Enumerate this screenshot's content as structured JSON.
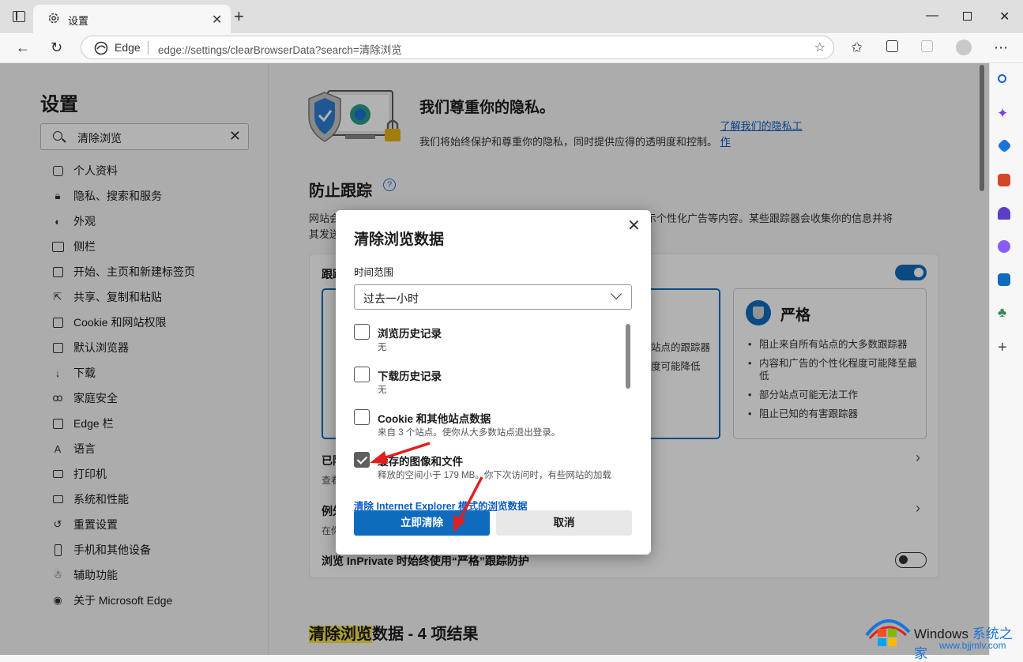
{
  "browser": {
    "tab_title": "设置",
    "address_site": "Edge",
    "address_url": "edge://settings/clearBrowserData?search=清除浏览"
  },
  "nav": {
    "title": "设置",
    "search_value": "清除浏览",
    "items": [
      {
        "label": "个人资料",
        "icon": "profile-icon"
      },
      {
        "label": "隐私、搜索和服务",
        "icon": "lock-icon"
      },
      {
        "label": "外观",
        "icon": "palette-icon"
      },
      {
        "label": "侧栏",
        "icon": "sidebar-icon"
      },
      {
        "label": "开始、主页和新建标签页",
        "icon": "home-icon"
      },
      {
        "label": "共享、复制和粘贴",
        "icon": "share-icon"
      },
      {
        "label": "Cookie 和网站权限",
        "icon": "cookie-icon"
      },
      {
        "label": "默认浏览器",
        "icon": "browser-icon"
      },
      {
        "label": "下载",
        "icon": "download-icon"
      },
      {
        "label": "家庭安全",
        "icon": "family-icon"
      },
      {
        "label": "Edge 栏",
        "icon": "edge-bar-icon"
      },
      {
        "label": "语言",
        "icon": "language-icon"
      },
      {
        "label": "打印机",
        "icon": "printer-icon"
      },
      {
        "label": "系统和性能",
        "icon": "laptop-icon"
      },
      {
        "label": "重置设置",
        "icon": "reset-icon"
      },
      {
        "label": "手机和其他设备",
        "icon": "phone-icon"
      },
      {
        "label": "辅助功能",
        "icon": "accessibility-icon"
      },
      {
        "label": "关于 Microsoft Edge",
        "icon": "edge-logo-icon"
      }
    ]
  },
  "main": {
    "privacy_title": "我们尊重你的隐私。",
    "privacy_desc": "我们将始终保护和尊重你的隐私，同时提供应得的透明度和控制。",
    "privacy_link": "了解我们的隐私工作",
    "tracking_title": "防止跟踪",
    "tracking_desc_start": "网站会",
    "tracking_desc_end": "你显示个性化广告等内容。某些跟踪器会收集你的信息并将",
    "tracking_desc_line2": "其发送",
    "card_label_partial": "跟踪",
    "balanced_line1": "站点的跟踪器",
    "balanced_line2": "度可能降低",
    "strict_title": "严格",
    "strict_bullets": [
      "阻止来自所有站点的大多数跟踪器",
      "内容和广告的个性化程度可能降至最低",
      "部分站点可能无法工作",
      "阻止已知的有害跟踪器"
    ],
    "row1_partial": "已阻",
    "row1_sub": "查看",
    "row2_partial": "例外",
    "row2_sub": "在你",
    "inprivate_label": "浏览 InPrivate 时始终使用“严格”跟踪防护",
    "results_highlight": "清除浏览",
    "results_rest": "数据 - 4 项结果"
  },
  "dialog": {
    "title": "清除浏览数据",
    "range_label": "时间范围",
    "range_value": "过去一小时",
    "options": [
      {
        "title": "浏览历史记录",
        "sub": "无",
        "checked": false
      },
      {
        "title": "下载历史记录",
        "sub": "无",
        "checked": false
      },
      {
        "title": "Cookie 和其他站点数据",
        "sub": "来自 3 个站点。使你从大多数站点退出登录。",
        "checked": false
      },
      {
        "title": "缓存的图像和文件",
        "sub": "释放的空间小于 179 MB。你下次访问时，有些网站的加载",
        "checked": true
      }
    ],
    "ie_link": "清除 Internet Explorer 模式的浏览数据",
    "clear_button": "立即清除",
    "cancel_button": "取消"
  },
  "watermark": {
    "brand_en": "Windows",
    "brand_cn": "系统之家",
    "url": "www.bjjmlv.com"
  },
  "colors": {
    "accent": "#0f6cbd",
    "annotation_arrow": "#e02020",
    "search_highlight": "#f7e34a"
  }
}
